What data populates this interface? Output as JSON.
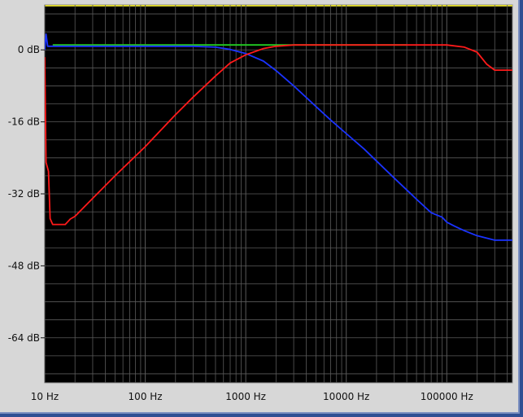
{
  "chart_data": {
    "type": "line",
    "title": "",
    "xlabel": "",
    "ylabel": "",
    "xscale": "log",
    "xlim": [
      10,
      450000
    ],
    "ylim": [
      -74,
      10
    ],
    "grid": true,
    "background": "#000000",
    "grid_color": "#5a5a5a",
    "x_ticks": [
      {
        "value": 10,
        "label": "10 Hz"
      },
      {
        "value": 100,
        "label": "100 Hz"
      },
      {
        "value": 1000,
        "label": "1000 Hz"
      },
      {
        "value": 10000,
        "label": "10000 Hz"
      },
      {
        "value": 100000,
        "label": "100000 Hz"
      }
    ],
    "y_ticks": [
      {
        "value": 0,
        "label": "0 dB"
      },
      {
        "value": -16,
        "label": "-16 dB"
      },
      {
        "value": -32,
        "label": "-32 dB"
      },
      {
        "value": -48,
        "label": "-48 dB"
      },
      {
        "value": -64,
        "label": "-64 dB"
      }
    ],
    "series": [
      {
        "color": "#22cc22",
        "x": [
          12,
          15,
          20,
          50,
          100,
          300,
          700,
          1000,
          2000,
          5000,
          10000,
          20000,
          40000
        ],
        "y": [
          1.1,
          1.1,
          1.1,
          1.1,
          1.1,
          1.1,
          1.1,
          1.1,
          1.1,
          1.1,
          1.1,
          1.1,
          1.1
        ]
      },
      {
        "color": "#1a33ff",
        "x": [
          10,
          10.3,
          10.7,
          12,
          20,
          50,
          100,
          200,
          300,
          500,
          700,
          1000,
          1500,
          2000,
          3000,
          5000,
          7000,
          10000,
          15000,
          20000,
          30000,
          50000,
          70000,
          90000,
          100000,
          120000,
          150000,
          200000,
          300000,
          450000
        ],
        "y": [
          0,
          3.5,
          0.8,
          0.8,
          0.8,
          0.8,
          0.8,
          0.8,
          0.8,
          0.6,
          0.1,
          -0.8,
          -2.5,
          -4.6,
          -8.0,
          -12.6,
          -15.6,
          -18.6,
          -22.0,
          -24.7,
          -28.5,
          -33.2,
          -36.2,
          -37.2,
          -38.3,
          -39.2,
          -40.2,
          -41.3,
          -42.3,
          -42.3
        ]
      },
      {
        "color": "#ff1a1a",
        "x": [
          10,
          10.3,
          10.6,
          10.9,
          11.3,
          12,
          14,
          16,
          18,
          20,
          30,
          50,
          100,
          200,
          300,
          500,
          700,
          1000,
          1500,
          2000,
          3000,
          5000,
          7000,
          10000,
          20000,
          50000,
          100000,
          150000,
          200000,
          250000,
          300000,
          450000
        ],
        "y": [
          -1.6,
          -25.0,
          -26.0,
          -27.0,
          -37.5,
          -38.8,
          -38.8,
          -38.8,
          -37.6,
          -37.0,
          -33.0,
          -28.0,
          -21.5,
          -14.4,
          -10.5,
          -5.8,
          -2.9,
          -1.1,
          0.3,
          0.8,
          1.1,
          1.1,
          1.1,
          1.1,
          1.1,
          1.1,
          1.1,
          0.6,
          -0.5,
          -3.2,
          -4.5,
          -4.5
        ]
      }
    ]
  }
}
